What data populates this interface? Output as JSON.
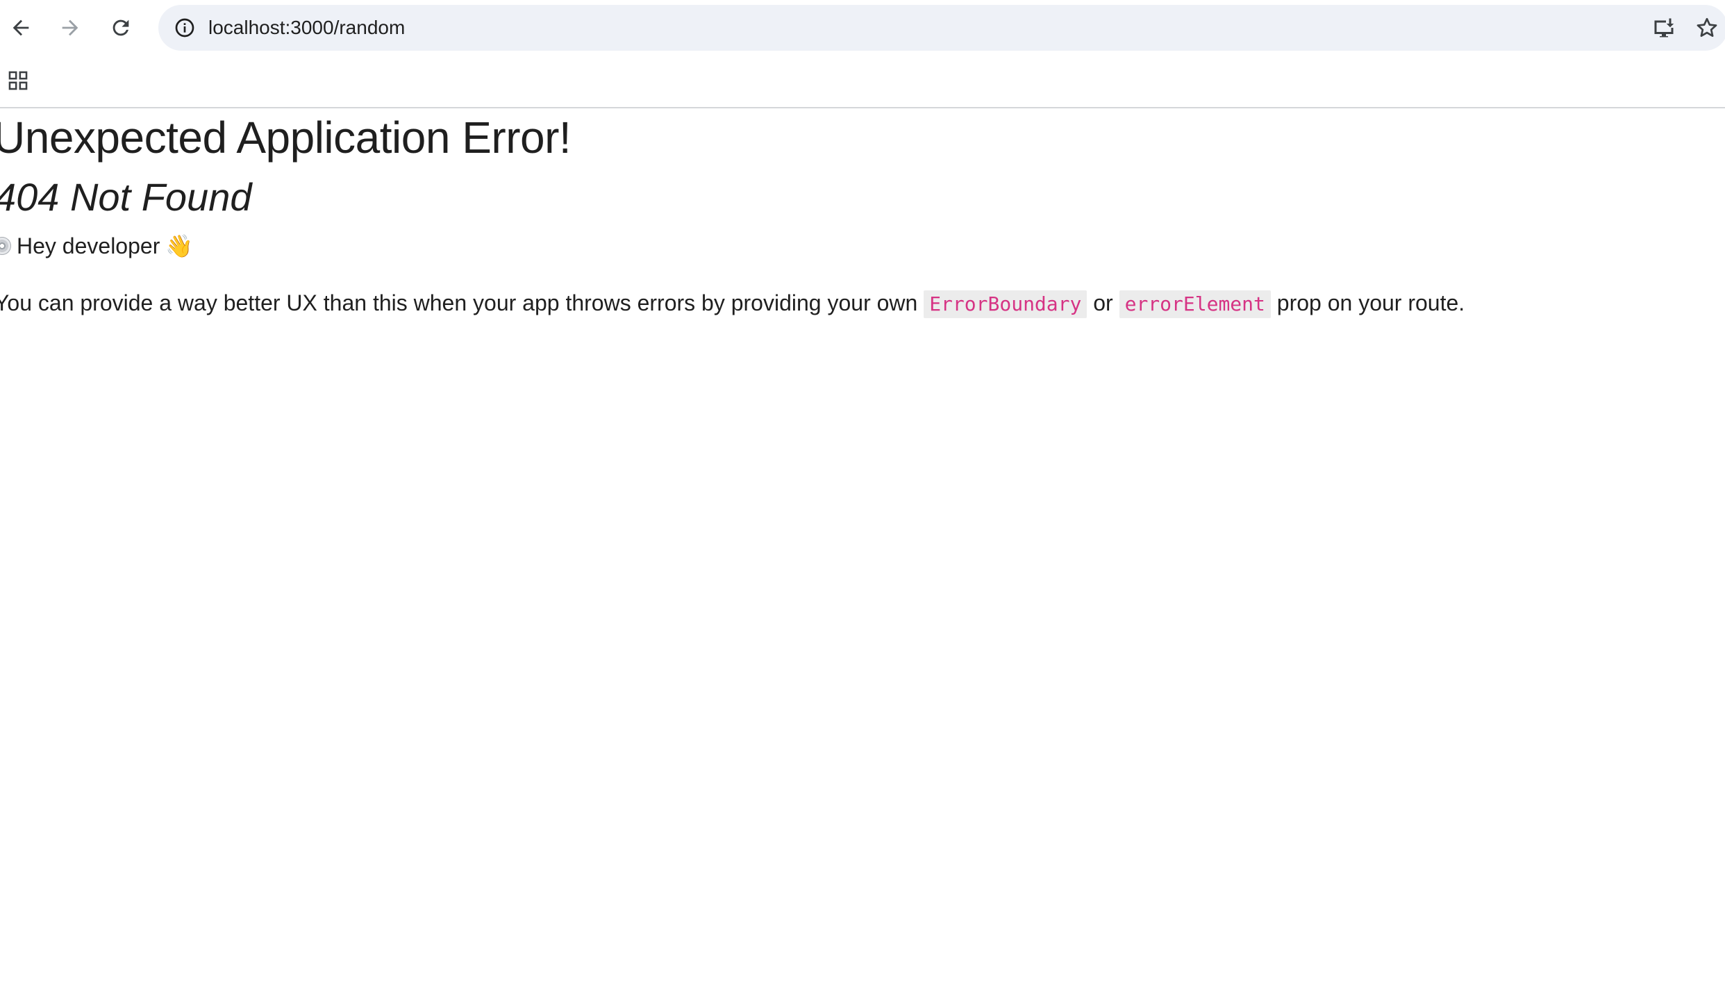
{
  "browser": {
    "url": "localhost:3000/random",
    "icons": {
      "back": "arrow-left-icon",
      "forward": "arrow-right-icon",
      "reload": "reload-icon",
      "site_info": "info-icon",
      "install": "install-app-icon",
      "bookmark": "star-icon",
      "apps": "apps-grid-icon"
    }
  },
  "page": {
    "title": "Unexpected Application Error!",
    "status": "404 Not Found",
    "hey": "Hey developer",
    "body_before": "You can provide a way better UX than this when your app throws errors by providing your own",
    "code1": "ErrorBoundary",
    "or_text": "or",
    "code2": "errorElement",
    "body_after": "prop on your route."
  },
  "colors": {
    "code_text": "#d63384",
    "code_bg": "#ececec",
    "omnibox_bg": "#eef1f7"
  }
}
